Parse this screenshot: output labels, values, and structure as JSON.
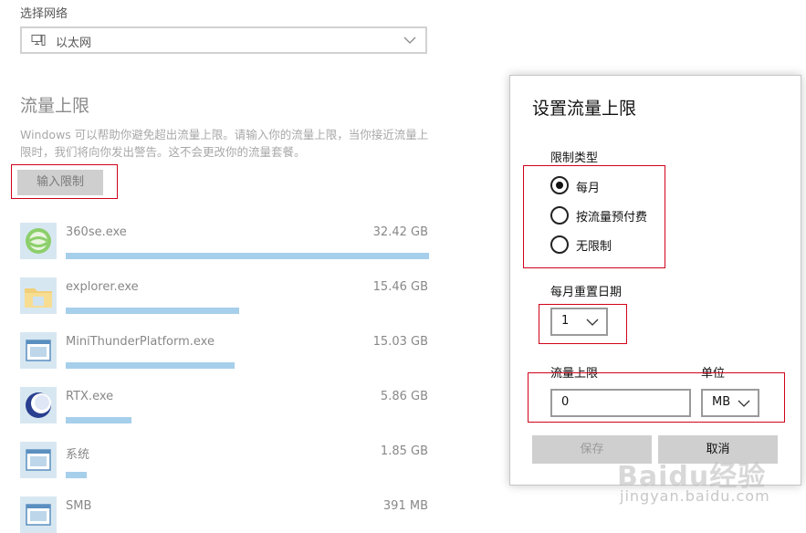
{
  "network": {
    "label": "选择网络",
    "selected": "以太网"
  },
  "data_limit": {
    "title": "流量上限",
    "description": "Windows 可以帮助你避免超出流量上限。请输入你的流量上限，当你接近流量上限时，我们将向你发出警告。这不会更改你的流量套餐。",
    "enter_limit_button": "输入限制"
  },
  "apps": [
    {
      "name": "360se.exe",
      "size": "32.42 GB",
      "usage_fraction": 1.0,
      "icon": "360se-icon"
    },
    {
      "name": "explorer.exe",
      "size": "15.46 GB",
      "usage_fraction": 0.477,
      "icon": "folder-icon"
    },
    {
      "name": "MiniThunderPlatform.exe",
      "size": "15.03 GB",
      "usage_fraction": 0.464,
      "icon": "app-window-icon"
    },
    {
      "name": "RTX.exe",
      "size": "5.86 GB",
      "usage_fraction": 0.181,
      "icon": "rtx-icon"
    },
    {
      "name": "系统",
      "size": "1.85 GB",
      "usage_fraction": 0.057,
      "icon": "app-window-icon"
    },
    {
      "name": "SMB",
      "size": "391 MB",
      "usage_fraction": 0.012,
      "icon": "app-window-icon"
    }
  ],
  "dialog": {
    "title": "设置流量上限",
    "limit_type_label": "限制类型",
    "options": [
      "每月",
      "按流量预付费",
      "无限制"
    ],
    "selected_option": "每月",
    "reset_date_label": "每月重置日期",
    "reset_date_value": "1",
    "limit_label": "流量上限",
    "limit_value": "0",
    "unit_label": "单位",
    "unit_value": "MB",
    "save_button": "保存",
    "cancel_button": "取消"
  },
  "watermark": {
    "main": "Baidu经验",
    "sub": "jingyan.baidu.com"
  },
  "colors": {
    "bar": "#a6cfeb",
    "highlight_box": "#d0021b",
    "button_bg": "#cfcfcf"
  }
}
